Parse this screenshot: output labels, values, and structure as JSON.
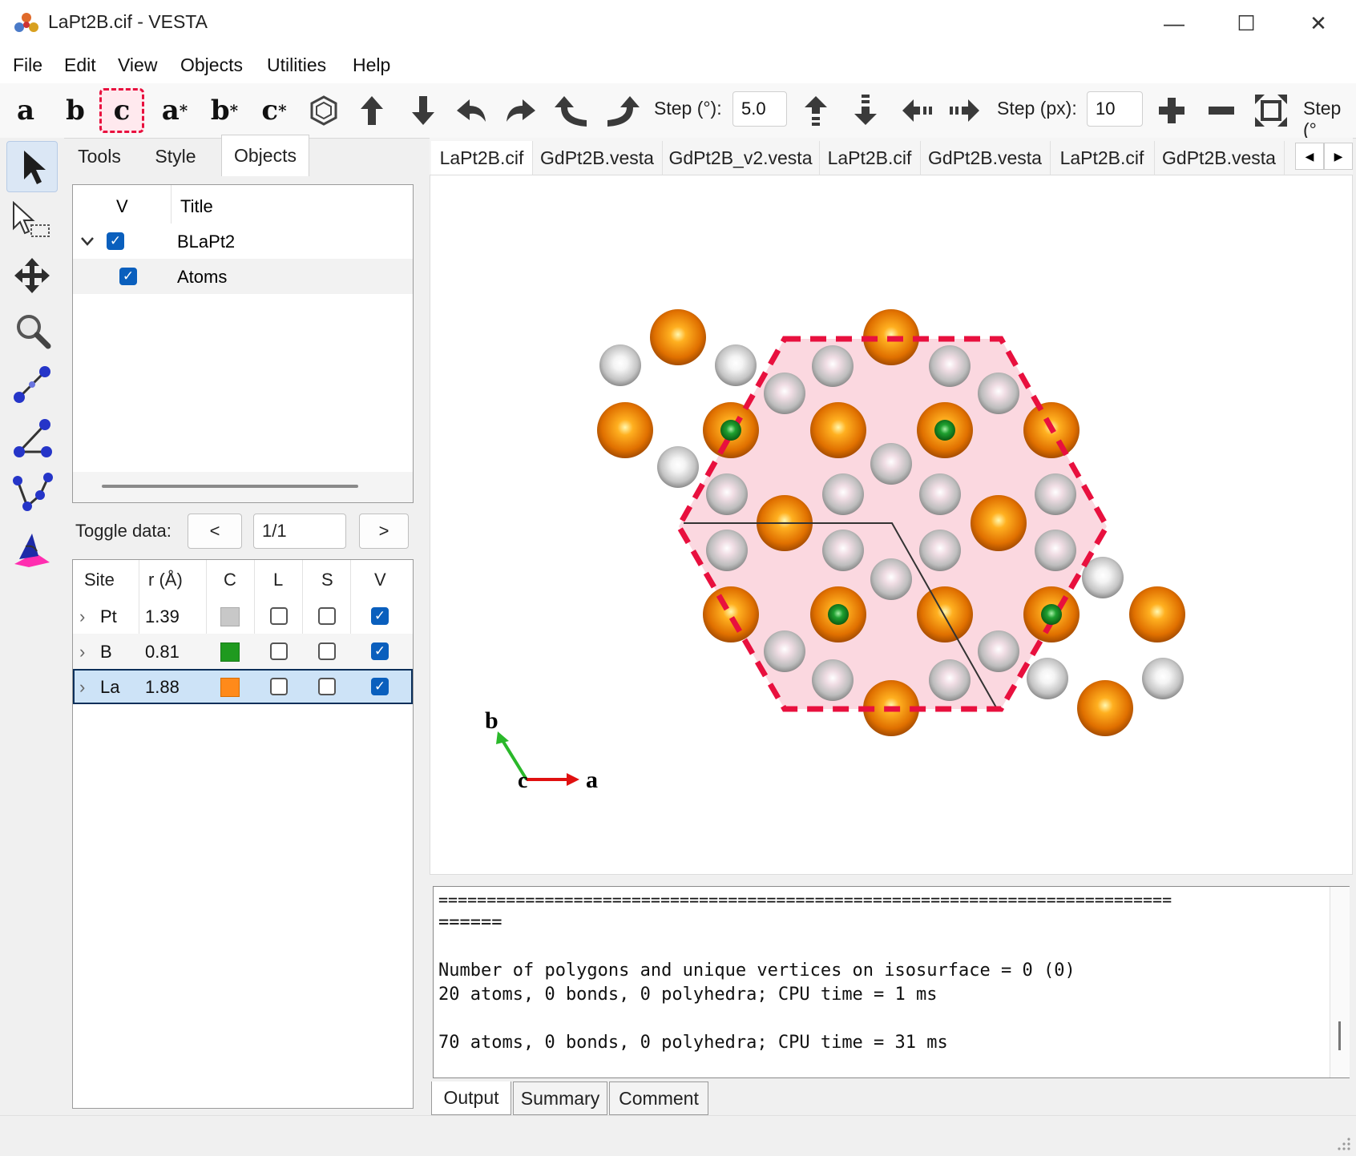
{
  "window": {
    "title": "LaPt2B.cif - VESTA",
    "min": "—",
    "max": "☐",
    "close": "✕"
  },
  "menu": [
    "File",
    "Edit",
    "View",
    "Objects",
    "Utilities",
    "Help"
  ],
  "toolbar": {
    "axes": [
      "a",
      "b",
      "c",
      "a",
      "b",
      "c"
    ],
    "star": "*",
    "step_deg_label": "Step (°):",
    "step_deg_value": "5.0",
    "step_px_label": "Step (px):",
    "step_px_value": "10",
    "step_cut_label": "Step (°"
  },
  "side_tabs": [
    "Tools",
    "Style",
    "Objects"
  ],
  "objects_tree": {
    "col_v": "V",
    "col_title": "Title",
    "rows": [
      {
        "title": "BLaPt2",
        "checked": true
      },
      {
        "title": "Atoms",
        "checked": true
      }
    ]
  },
  "toggle": {
    "label": "Toggle data:",
    "prev": "<",
    "value": "1/1",
    "next": ">"
  },
  "site_table": {
    "headers": [
      "Site",
      "r (Å)",
      "C",
      "L",
      "S",
      "V"
    ],
    "rows": [
      {
        "site": "Pt",
        "r": "1.39",
        "color": "#c8c8c8",
        "L": false,
        "S": false,
        "V": true
      },
      {
        "site": "B",
        "r": "0.81",
        "color": "#1f9a1f",
        "L": false,
        "S": false,
        "V": true
      },
      {
        "site": "La",
        "r": "1.88",
        "color": "#ff8a1a",
        "L": false,
        "S": false,
        "V": true
      }
    ]
  },
  "file_tabs": [
    "LaPt2B.cif",
    "GdPt2B.vesta",
    "GdPt2B_v2.vesta",
    "LaPt2B.cif",
    "GdPt2B.vesta",
    "LaPt2B.cif",
    "GdPt2B.vesta"
  ],
  "axis_labels": {
    "a": "a",
    "b": "b",
    "c": "c"
  },
  "colors": {
    "la": "#f07d0a",
    "pt": "#d4d4d4",
    "b": "#1c9c2a",
    "highlight": "#e8103e",
    "selection_bg": "#cde3f7"
  },
  "console": {
    "lines": [
      "============================================================================",
      "======",
      "",
      "Number of polygons and unique vertices on isosurface = 0 (0)",
      "20 atoms, 0 bonds, 0 polyhedra; CPU time = 1 ms",
      "",
      "70 atoms, 0 bonds, 0 polyhedra; CPU time = 31 ms"
    ]
  },
  "bottom_tabs": [
    "Output",
    "Summary",
    "Comment"
  ]
}
